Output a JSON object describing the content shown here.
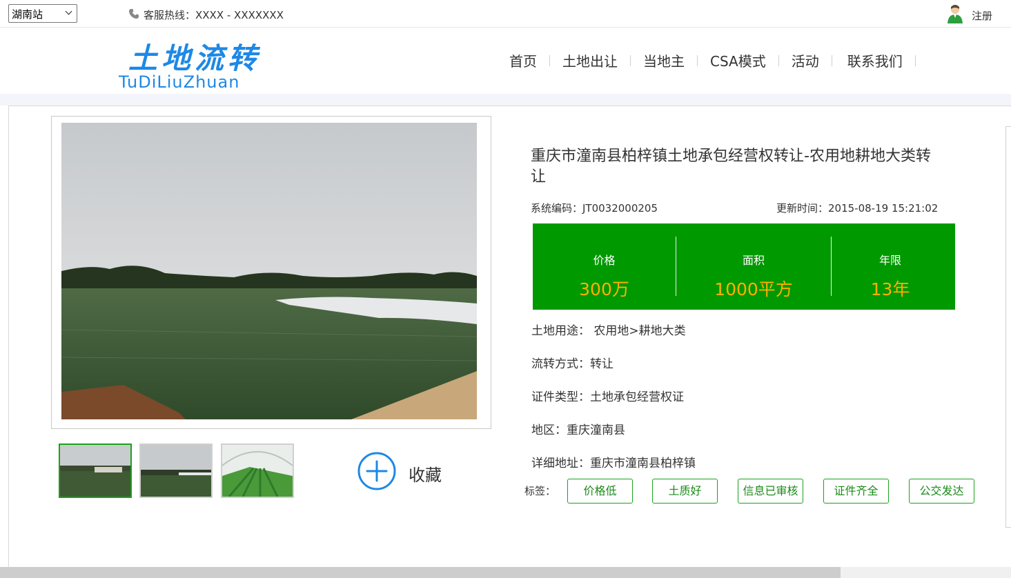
{
  "topbar": {
    "site_select": "湖南站",
    "hotline": "客服热线：XXXX - XXXXXXX",
    "register": "注册"
  },
  "header": {
    "logo_cn": "土地流转",
    "logo_en": "TuDiLiuZhuan",
    "nav": [
      "首页",
      "土地出让",
      "当地主",
      "CSA模式",
      "活动",
      "联系我们"
    ]
  },
  "listing": {
    "title": "重庆市潼南县柏梓镇土地承包经营权转让-农用地耕地大类转让",
    "code": "系统编码：JT0032000205",
    "updated": "更新时间：2015-08-19 15:21:02",
    "stats": [
      {
        "label": "价格",
        "value": "300万"
      },
      {
        "label": "面积",
        "value": "1000平方"
      },
      {
        "label": "年限",
        "value": "13年"
      }
    ],
    "fields": [
      "土地用途：  农用地>耕地大类",
      "流转方式：转让",
      "证件类型：土地承包经营权证",
      "地区：重庆潼南县",
      "详细地址：重庆市潼南县柏梓镇"
    ],
    "tags_label": "标签：",
    "tags": [
      "价格低",
      "土质好",
      "信息已审核",
      "证件齐全",
      "公交发达"
    ],
    "favorite": "收藏"
  },
  "colors": {
    "accent_green": "#009900",
    "stat_value": "#ffb000",
    "logo_blue": "#1e88e5"
  },
  "icons": {
    "phone": "phone-icon",
    "user": "user-avatar-icon",
    "plus": "plus-circle-icon"
  }
}
